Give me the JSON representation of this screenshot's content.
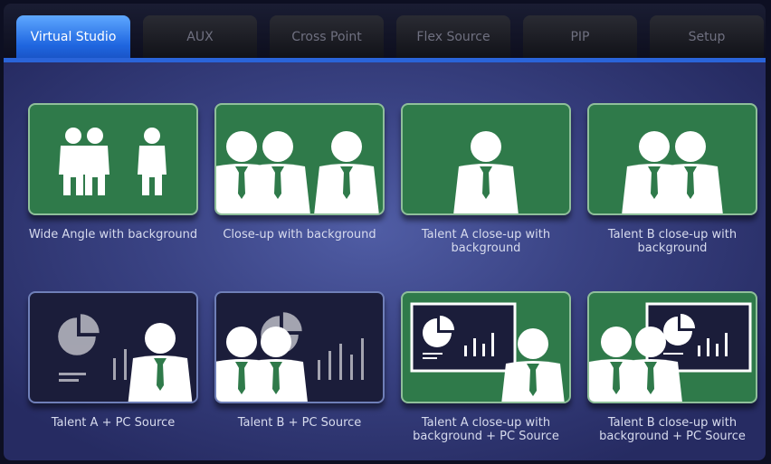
{
  "tabs": [
    {
      "label": "Virtual Studio",
      "active": true
    },
    {
      "label": "AUX",
      "active": false
    },
    {
      "label": "Cross Point",
      "active": false
    },
    {
      "label": "Flex Source",
      "active": false
    },
    {
      "label": "PIP",
      "active": false
    },
    {
      "label": "Setup",
      "active": false
    }
  ],
  "presets": [
    {
      "label": "Wide Angle with background",
      "icon": "wide-angle-icon",
      "style": "green"
    },
    {
      "label": "Close-up with background",
      "icon": "close-up-icon",
      "style": "green"
    },
    {
      "label": "Talent A close-up with background",
      "icon": "talent-a-icon",
      "style": "green"
    },
    {
      "label": "Talent B close-up with background",
      "icon": "talent-b-icon",
      "style": "green"
    },
    {
      "label": "Talent A + PC Source",
      "icon": "talent-a-pc-icon",
      "style": "dark"
    },
    {
      "label": "Talent B + PC Source",
      "icon": "talent-b-pc-icon",
      "style": "dark"
    },
    {
      "label": "Talent A close-up with background + PC Source",
      "icon": "talent-a-bg-pc-icon",
      "style": "green"
    },
    {
      "label": "Talent B close-up with background + PC Source",
      "icon": "talent-b-bg-pc-icon",
      "style": "green"
    }
  ],
  "colors": {
    "accent": "#2a64d9",
    "card_green": "#2f7a4a",
    "card_dark": "#1b1d3a",
    "label_text": "#d7dbee"
  }
}
